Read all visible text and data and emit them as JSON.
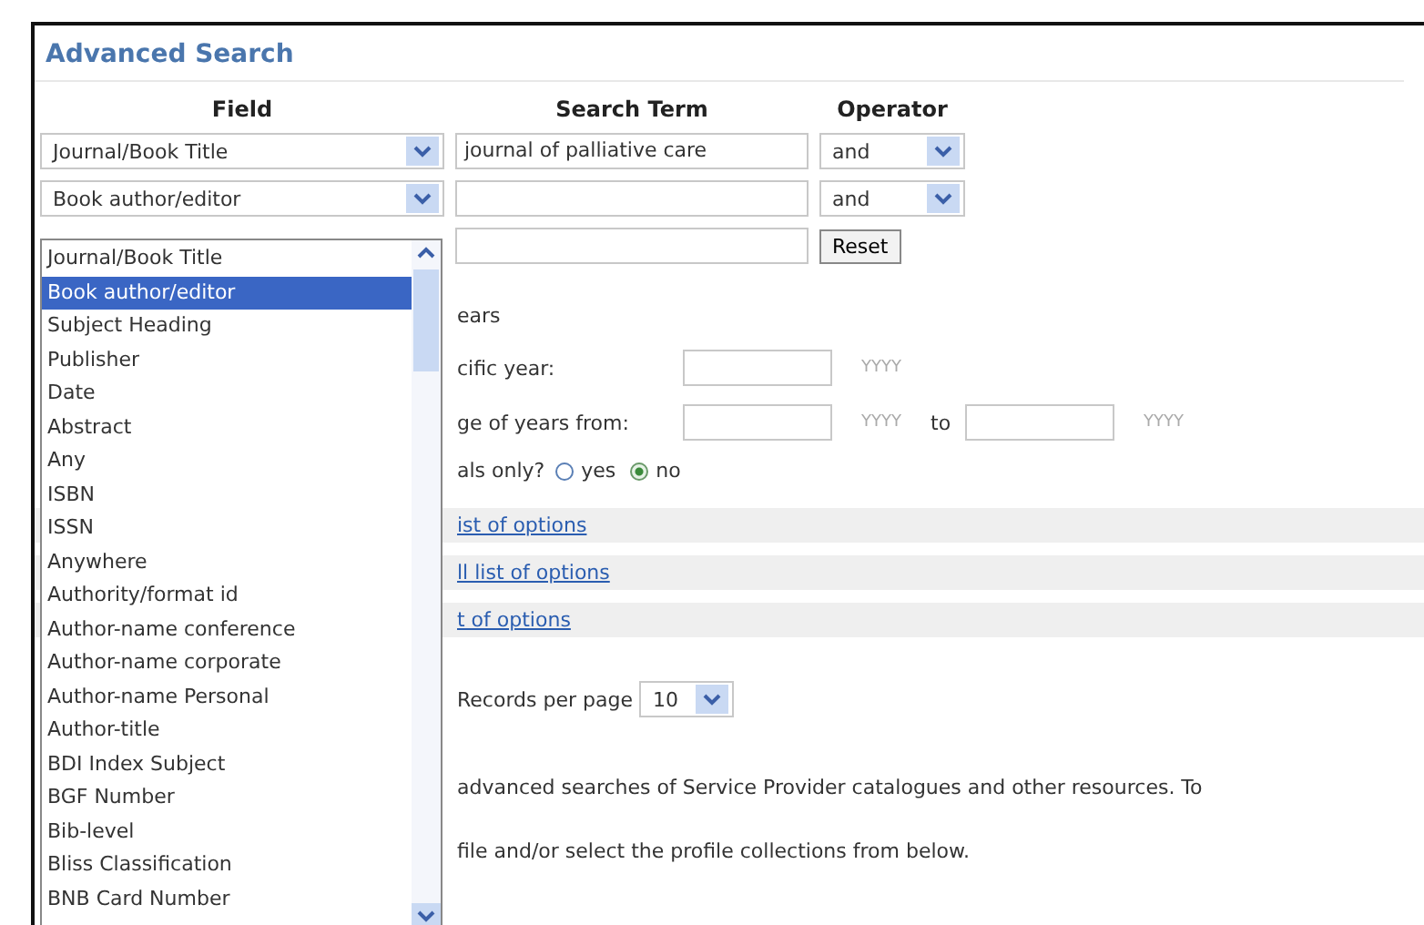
{
  "title": "Advanced Search",
  "columns": [
    "Field",
    "Search Term",
    "Operator"
  ],
  "rows": [
    {
      "field": "Journal/Book Title",
      "term": "journal of palliative care",
      "last": {
        "kind": "select",
        "value": "and"
      }
    },
    {
      "field": "Book author/editor",
      "last": {
        "kind": "select",
        "value": "and"
      }
    },
    {
      "last": {
        "kind": "button",
        "value": "Reset"
      }
    }
  ],
  "dropdown": {
    "items": [
      {
        "label": "Journal/Book Title",
        "selected": false
      },
      {
        "label": "Book author/editor",
        "selected": true
      },
      {
        "label": "Subject Heading",
        "selected": false
      },
      {
        "label": "Publisher",
        "selected": false
      },
      {
        "label": "Date",
        "selected": false
      },
      {
        "label": "Abstract",
        "selected": false
      },
      {
        "label": "Any",
        "selected": false
      },
      {
        "label": "ISBN",
        "selected": false
      },
      {
        "label": "ISSN",
        "selected": false
      },
      {
        "label": "Anywhere",
        "selected": false
      },
      {
        "label": "Authority/format id",
        "selected": false
      },
      {
        "label": "Author-name conference",
        "selected": false
      },
      {
        "label": "Author-name corporate",
        "selected": false
      },
      {
        "label": "Author-name Personal",
        "selected": false
      },
      {
        "label": "Author-title",
        "selected": false
      },
      {
        "label": "BDI Index Subject",
        "selected": false
      },
      {
        "label": "BGF Number",
        "selected": false
      },
      {
        "label": "Bib-level",
        "selected": false
      },
      {
        "label": "Bliss Classification",
        "selected": false
      },
      {
        "label": "BNB Card Number",
        "selected": false
      }
    ]
  },
  "years": {
    "heading": "ears",
    "specific_label": "cific year:",
    "specific_hint": "YYYY",
    "range_label": "ge of years from:",
    "from_hint": "YYYY",
    "to": "to",
    "to_hint": "YYYY"
  },
  "journals_only": {
    "label": "als only?",
    "options": [
      {
        "label": "yes",
        "selected": false
      },
      {
        "label": "no",
        "selected": true
      }
    ]
  },
  "option_links": [
    "ist of options",
    "ll list of options",
    "t of options"
  ],
  "records_per_page": {
    "label": "Records per page",
    "value": "10"
  },
  "notes": [
    "advanced searches of Service Provider catalogues and other resources. To",
    "file and/or select the profile collections from below."
  ]
}
